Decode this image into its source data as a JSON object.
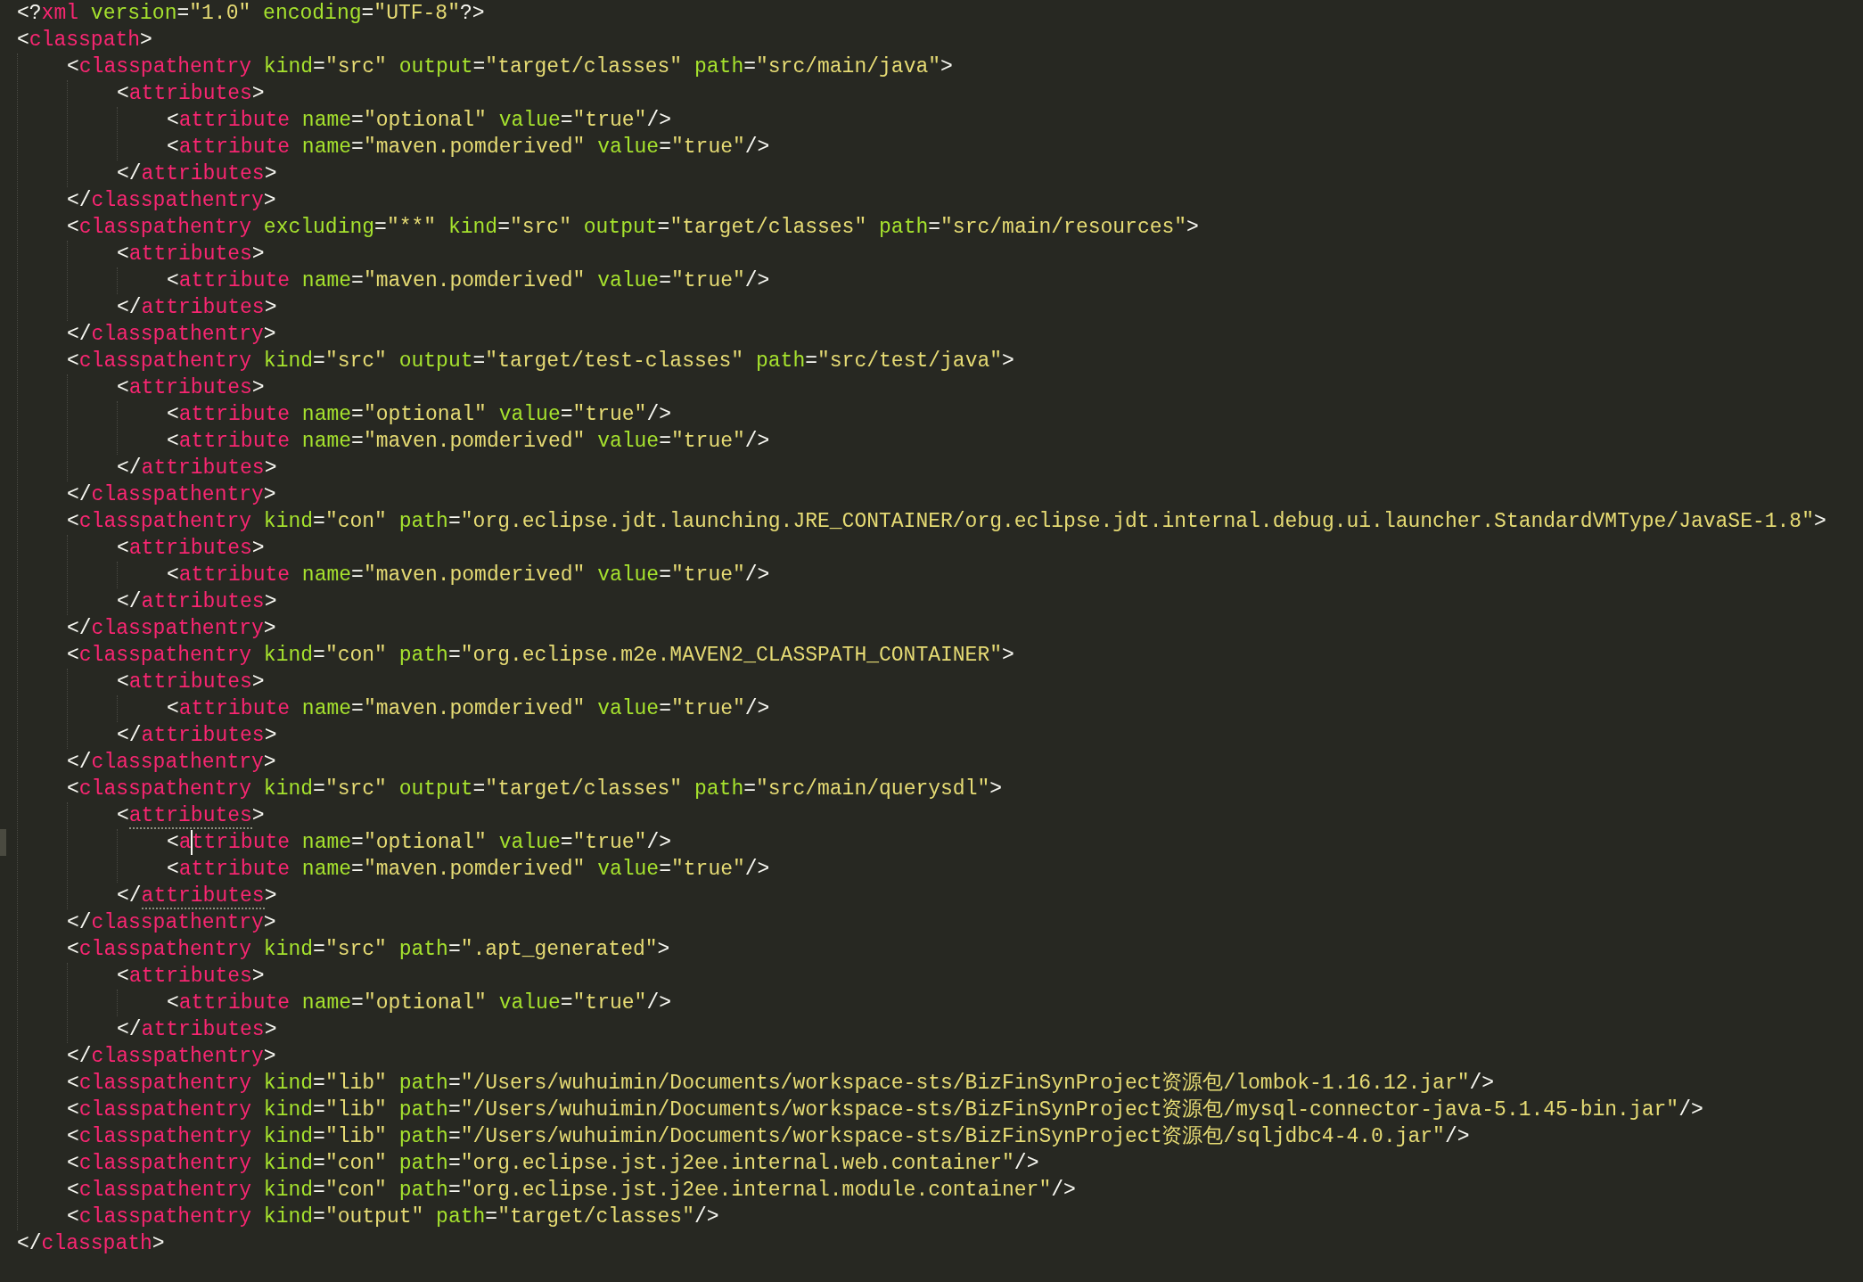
{
  "editor": {
    "lines": [
      {
        "tokens": [
          {
            "kind": "punct",
            "text": "<?"
          },
          {
            "kind": "tag",
            "text": "xml"
          },
          {
            "kind": "attr",
            "text": " version"
          },
          {
            "kind": "punct",
            "text": "="
          },
          {
            "kind": "string",
            "text": "\"1.0\""
          },
          {
            "kind": "attr",
            "text": " encoding"
          },
          {
            "kind": "punct",
            "text": "="
          },
          {
            "kind": "string",
            "text": "\"UTF-8\""
          },
          {
            "kind": "punct",
            "text": "?>"
          }
        ]
      },
      {
        "tokens": [
          {
            "kind": "punct",
            "text": "<"
          },
          {
            "kind": "tag",
            "text": "classpath"
          },
          {
            "kind": "punct",
            "text": ">"
          }
        ],
        "children": [
          {
            "tokens": [
              {
                "kind": "punct",
                "text": "<"
              },
              {
                "kind": "tag",
                "text": "classpathentry"
              },
              {
                "kind": "attr",
                "text": " kind"
              },
              {
                "kind": "punct",
                "text": "="
              },
              {
                "kind": "string",
                "text": "\"src\""
              },
              {
                "kind": "attr",
                "text": " output"
              },
              {
                "kind": "punct",
                "text": "="
              },
              {
                "kind": "string",
                "text": "\"target/classes\""
              },
              {
                "kind": "attr",
                "text": " path"
              },
              {
                "kind": "punct",
                "text": "="
              },
              {
                "kind": "string",
                "text": "\"src/main/java\""
              },
              {
                "kind": "punct",
                "text": ">"
              }
            ],
            "children": [
              {
                "tokens": [
                  {
                    "kind": "punct",
                    "text": "<"
                  },
                  {
                    "kind": "tag",
                    "text": "attributes"
                  },
                  {
                    "kind": "punct",
                    "text": ">"
                  }
                ],
                "children": [
                  {
                    "tokens": [
                      {
                        "kind": "punct",
                        "text": "<"
                      },
                      {
                        "kind": "tag",
                        "text": "attribute"
                      },
                      {
                        "kind": "attr",
                        "text": " name"
                      },
                      {
                        "kind": "punct",
                        "text": "="
                      },
                      {
                        "kind": "string",
                        "text": "\"optional\""
                      },
                      {
                        "kind": "attr",
                        "text": " value"
                      },
                      {
                        "kind": "punct",
                        "text": "="
                      },
                      {
                        "kind": "string",
                        "text": "\"true\""
                      },
                      {
                        "kind": "punct",
                        "text": "/>"
                      }
                    ]
                  },
                  {
                    "tokens": [
                      {
                        "kind": "punct",
                        "text": "<"
                      },
                      {
                        "kind": "tag",
                        "text": "attribute"
                      },
                      {
                        "kind": "attr",
                        "text": " name"
                      },
                      {
                        "kind": "punct",
                        "text": "="
                      },
                      {
                        "kind": "string",
                        "text": "\"maven.pomderived\""
                      },
                      {
                        "kind": "attr",
                        "text": " value"
                      },
                      {
                        "kind": "punct",
                        "text": "="
                      },
                      {
                        "kind": "string",
                        "text": "\"true\""
                      },
                      {
                        "kind": "punct",
                        "text": "/>"
                      }
                    ]
                  }
                ]
              },
              {
                "tokens": [
                  {
                    "kind": "punct",
                    "text": "</"
                  },
                  {
                    "kind": "tag",
                    "text": "attributes"
                  },
                  {
                    "kind": "punct",
                    "text": ">"
                  }
                ]
              }
            ]
          },
          {
            "tokens": [
              {
                "kind": "punct",
                "text": "</"
              },
              {
                "kind": "tag",
                "text": "classpathentry"
              },
              {
                "kind": "punct",
                "text": ">"
              }
            ]
          },
          {
            "tokens": [
              {
                "kind": "punct",
                "text": "<"
              },
              {
                "kind": "tag",
                "text": "classpathentry"
              },
              {
                "kind": "attr",
                "text": " excluding"
              },
              {
                "kind": "punct",
                "text": "="
              },
              {
                "kind": "string",
                "text": "\"**\""
              },
              {
                "kind": "attr",
                "text": " kind"
              },
              {
                "kind": "punct",
                "text": "="
              },
              {
                "kind": "string",
                "text": "\"src\""
              },
              {
                "kind": "attr",
                "text": " output"
              },
              {
                "kind": "punct",
                "text": "="
              },
              {
                "kind": "string",
                "text": "\"target/classes\""
              },
              {
                "kind": "attr",
                "text": " path"
              },
              {
                "kind": "punct",
                "text": "="
              },
              {
                "kind": "string",
                "text": "\"src/main/resources\""
              },
              {
                "kind": "punct",
                "text": ">"
              }
            ],
            "children": [
              {
                "tokens": [
                  {
                    "kind": "punct",
                    "text": "<"
                  },
                  {
                    "kind": "tag",
                    "text": "attributes"
                  },
                  {
                    "kind": "punct",
                    "text": ">"
                  }
                ],
                "children": [
                  {
                    "tokens": [
                      {
                        "kind": "punct",
                        "text": "<"
                      },
                      {
                        "kind": "tag",
                        "text": "attribute"
                      },
                      {
                        "kind": "attr",
                        "text": " name"
                      },
                      {
                        "kind": "punct",
                        "text": "="
                      },
                      {
                        "kind": "string",
                        "text": "\"maven.pomderived\""
                      },
                      {
                        "kind": "attr",
                        "text": " value"
                      },
                      {
                        "kind": "punct",
                        "text": "="
                      },
                      {
                        "kind": "string",
                        "text": "\"true\""
                      },
                      {
                        "kind": "punct",
                        "text": "/>"
                      }
                    ]
                  }
                ]
              },
              {
                "tokens": [
                  {
                    "kind": "punct",
                    "text": "</"
                  },
                  {
                    "kind": "tag",
                    "text": "attributes"
                  },
                  {
                    "kind": "punct",
                    "text": ">"
                  }
                ]
              }
            ]
          },
          {
            "tokens": [
              {
                "kind": "punct",
                "text": "</"
              },
              {
                "kind": "tag",
                "text": "classpathentry"
              },
              {
                "kind": "punct",
                "text": ">"
              }
            ]
          },
          {
            "tokens": [
              {
                "kind": "punct",
                "text": "<"
              },
              {
                "kind": "tag",
                "text": "classpathentry"
              },
              {
                "kind": "attr",
                "text": " kind"
              },
              {
                "kind": "punct",
                "text": "="
              },
              {
                "kind": "string",
                "text": "\"src\""
              },
              {
                "kind": "attr",
                "text": " output"
              },
              {
                "kind": "punct",
                "text": "="
              },
              {
                "kind": "string",
                "text": "\"target/test-classes\""
              },
              {
                "kind": "attr",
                "text": " path"
              },
              {
                "kind": "punct",
                "text": "="
              },
              {
                "kind": "string",
                "text": "\"src/test/java\""
              },
              {
                "kind": "punct",
                "text": ">"
              }
            ],
            "children": [
              {
                "tokens": [
                  {
                    "kind": "punct",
                    "text": "<"
                  },
                  {
                    "kind": "tag",
                    "text": "attributes"
                  },
                  {
                    "kind": "punct",
                    "text": ">"
                  }
                ],
                "children": [
                  {
                    "tokens": [
                      {
                        "kind": "punct",
                        "text": "<"
                      },
                      {
                        "kind": "tag",
                        "text": "attribute"
                      },
                      {
                        "kind": "attr",
                        "text": " name"
                      },
                      {
                        "kind": "punct",
                        "text": "="
                      },
                      {
                        "kind": "string",
                        "text": "\"optional\""
                      },
                      {
                        "kind": "attr",
                        "text": " value"
                      },
                      {
                        "kind": "punct",
                        "text": "="
                      },
                      {
                        "kind": "string",
                        "text": "\"true\""
                      },
                      {
                        "kind": "punct",
                        "text": "/>"
                      }
                    ]
                  },
                  {
                    "tokens": [
                      {
                        "kind": "punct",
                        "text": "<"
                      },
                      {
                        "kind": "tag",
                        "text": "attribute"
                      },
                      {
                        "kind": "attr",
                        "text": " name"
                      },
                      {
                        "kind": "punct",
                        "text": "="
                      },
                      {
                        "kind": "string",
                        "text": "\"maven.pomderived\""
                      },
                      {
                        "kind": "attr",
                        "text": " value"
                      },
                      {
                        "kind": "punct",
                        "text": "="
                      },
                      {
                        "kind": "string",
                        "text": "\"true\""
                      },
                      {
                        "kind": "punct",
                        "text": "/>"
                      }
                    ]
                  }
                ]
              },
              {
                "tokens": [
                  {
                    "kind": "punct",
                    "text": "</"
                  },
                  {
                    "kind": "tag",
                    "text": "attributes"
                  },
                  {
                    "kind": "punct",
                    "text": ">"
                  }
                ]
              }
            ]
          },
          {
            "tokens": [
              {
                "kind": "punct",
                "text": "</"
              },
              {
                "kind": "tag",
                "text": "classpathentry"
              },
              {
                "kind": "punct",
                "text": ">"
              }
            ]
          },
          {
            "tokens": [
              {
                "kind": "punct",
                "text": "<"
              },
              {
                "kind": "tag",
                "text": "classpathentry"
              },
              {
                "kind": "attr",
                "text": " kind"
              },
              {
                "kind": "punct",
                "text": "="
              },
              {
                "kind": "string",
                "text": "\"con\""
              },
              {
                "kind": "attr",
                "text": " path"
              },
              {
                "kind": "punct",
                "text": "="
              },
              {
                "kind": "string",
                "text": "\"org.eclipse.jdt.launching.JRE_CONTAINER/org.eclipse.jdt.internal.debug.ui.launcher.StandardVMType/JavaSE-1.8\""
              },
              {
                "kind": "punct",
                "text": ">"
              }
            ],
            "children": [
              {
                "tokens": [
                  {
                    "kind": "punct",
                    "text": "<"
                  },
                  {
                    "kind": "tag",
                    "text": "attributes"
                  },
                  {
                    "kind": "punct",
                    "text": ">"
                  }
                ],
                "children": [
                  {
                    "tokens": [
                      {
                        "kind": "punct",
                        "text": "<"
                      },
                      {
                        "kind": "tag",
                        "text": "attribute"
                      },
                      {
                        "kind": "attr",
                        "text": " name"
                      },
                      {
                        "kind": "punct",
                        "text": "="
                      },
                      {
                        "kind": "string",
                        "text": "\"maven.pomderived\""
                      },
                      {
                        "kind": "attr",
                        "text": " value"
                      },
                      {
                        "kind": "punct",
                        "text": "="
                      },
                      {
                        "kind": "string",
                        "text": "\"true\""
                      },
                      {
                        "kind": "punct",
                        "text": "/>"
                      }
                    ]
                  }
                ]
              },
              {
                "tokens": [
                  {
                    "kind": "punct",
                    "text": "</"
                  },
                  {
                    "kind": "tag",
                    "text": "attributes"
                  },
                  {
                    "kind": "punct",
                    "text": ">"
                  }
                ]
              }
            ]
          },
          {
            "tokens": [
              {
                "kind": "punct",
                "text": "</"
              },
              {
                "kind": "tag",
                "text": "classpathentry"
              },
              {
                "kind": "punct",
                "text": ">"
              }
            ]
          },
          {
            "tokens": [
              {
                "kind": "punct",
                "text": "<"
              },
              {
                "kind": "tag",
                "text": "classpathentry"
              },
              {
                "kind": "attr",
                "text": " kind"
              },
              {
                "kind": "punct",
                "text": "="
              },
              {
                "kind": "string",
                "text": "\"con\""
              },
              {
                "kind": "attr",
                "text": " path"
              },
              {
                "kind": "punct",
                "text": "="
              },
              {
                "kind": "string",
                "text": "\"org.eclipse.m2e.MAVEN2_CLASSPATH_CONTAINER\""
              },
              {
                "kind": "punct",
                "text": ">"
              }
            ],
            "children": [
              {
                "tokens": [
                  {
                    "kind": "punct",
                    "text": "<"
                  },
                  {
                    "kind": "tag",
                    "text": "attributes"
                  },
                  {
                    "kind": "punct",
                    "text": ">"
                  }
                ],
                "children": [
                  {
                    "tokens": [
                      {
                        "kind": "punct",
                        "text": "<"
                      },
                      {
                        "kind": "tag",
                        "text": "attribute"
                      },
                      {
                        "kind": "attr",
                        "text": " name"
                      },
                      {
                        "kind": "punct",
                        "text": "="
                      },
                      {
                        "kind": "string",
                        "text": "\"maven.pomderived\""
                      },
                      {
                        "kind": "attr",
                        "text": " value"
                      },
                      {
                        "kind": "punct",
                        "text": "="
                      },
                      {
                        "kind": "string",
                        "text": "\"true\""
                      },
                      {
                        "kind": "punct",
                        "text": "/>"
                      }
                    ]
                  }
                ]
              },
              {
                "tokens": [
                  {
                    "kind": "punct",
                    "text": "</"
                  },
                  {
                    "kind": "tag",
                    "text": "attributes"
                  },
                  {
                    "kind": "punct",
                    "text": ">"
                  }
                ]
              }
            ]
          },
          {
            "tokens": [
              {
                "kind": "punct",
                "text": "</"
              },
              {
                "kind": "tag",
                "text": "classpathentry"
              },
              {
                "kind": "punct",
                "text": ">"
              }
            ]
          },
          {
            "tokens": [
              {
                "kind": "punct",
                "text": "<"
              },
              {
                "kind": "tag",
                "text": "classpathentry"
              },
              {
                "kind": "attr",
                "text": " kind"
              },
              {
                "kind": "punct",
                "text": "="
              },
              {
                "kind": "string",
                "text": "\"src\""
              },
              {
                "kind": "attr",
                "text": " output"
              },
              {
                "kind": "punct",
                "text": "="
              },
              {
                "kind": "string",
                "text": "\"target/classes\""
              },
              {
                "kind": "attr",
                "text": " path"
              },
              {
                "kind": "punct",
                "text": "="
              },
              {
                "kind": "string",
                "text": "\"src/main/querysdl\""
              },
              {
                "kind": "punct",
                "text": ">"
              }
            ],
            "children": [
              {
                "tokens": [
                  {
                    "kind": "punct",
                    "text": "<"
                  },
                  {
                    "kind": "matched_tag",
                    "text": "attributes"
                  },
                  {
                    "kind": "punct",
                    "text": ">"
                  }
                ],
                "children": [
                  {
                    "tokens": [
                      {
                        "kind": "punct",
                        "text": "<"
                      },
                      {
                        "kind": "tag",
                        "text": "a"
                      },
                      {
                        "kind": "caret"
                      },
                      {
                        "kind": "tag",
                        "text": "ttribute"
                      },
                      {
                        "kind": "attr",
                        "text": " name"
                      },
                      {
                        "kind": "punct",
                        "text": "="
                      },
                      {
                        "kind": "string",
                        "text": "\"optional\""
                      },
                      {
                        "kind": "attr",
                        "text": " value"
                      },
                      {
                        "kind": "punct",
                        "text": "="
                      },
                      {
                        "kind": "string",
                        "text": "\"true\""
                      },
                      {
                        "kind": "punct",
                        "text": "/>"
                      }
                    ]
                  },
                  {
                    "tokens": [
                      {
                        "kind": "punct",
                        "text": "<"
                      },
                      {
                        "kind": "tag",
                        "text": "attribute"
                      },
                      {
                        "kind": "attr",
                        "text": " name"
                      },
                      {
                        "kind": "punct",
                        "text": "="
                      },
                      {
                        "kind": "string",
                        "text": "\"maven.pomderived\""
                      },
                      {
                        "kind": "attr",
                        "text": " value"
                      },
                      {
                        "kind": "punct",
                        "text": "="
                      },
                      {
                        "kind": "string",
                        "text": "\"true\""
                      },
                      {
                        "kind": "punct",
                        "text": "/>"
                      }
                    ]
                  }
                ]
              },
              {
                "tokens": [
                  {
                    "kind": "punct",
                    "text": "</"
                  },
                  {
                    "kind": "matched_tag",
                    "text": "attributes"
                  },
                  {
                    "kind": "punct",
                    "text": ">"
                  }
                ]
              }
            ]
          },
          {
            "tokens": [
              {
                "kind": "punct",
                "text": "</"
              },
              {
                "kind": "tag",
                "text": "classpathentry"
              },
              {
                "kind": "punct",
                "text": ">"
              }
            ]
          },
          {
            "tokens": [
              {
                "kind": "punct",
                "text": "<"
              },
              {
                "kind": "tag",
                "text": "classpathentry"
              },
              {
                "kind": "attr",
                "text": " kind"
              },
              {
                "kind": "punct",
                "text": "="
              },
              {
                "kind": "string",
                "text": "\"src\""
              },
              {
                "kind": "attr",
                "text": " path"
              },
              {
                "kind": "punct",
                "text": "="
              },
              {
                "kind": "string",
                "text": "\".apt_generated\""
              },
              {
                "kind": "punct",
                "text": ">"
              }
            ],
            "children": [
              {
                "tokens": [
                  {
                    "kind": "punct",
                    "text": "<"
                  },
                  {
                    "kind": "tag",
                    "text": "attributes"
                  },
                  {
                    "kind": "punct",
                    "text": ">"
                  }
                ],
                "children": [
                  {
                    "tokens": [
                      {
                        "kind": "punct",
                        "text": "<"
                      },
                      {
                        "kind": "tag",
                        "text": "attribute"
                      },
                      {
                        "kind": "attr",
                        "text": " name"
                      },
                      {
                        "kind": "punct",
                        "text": "="
                      },
                      {
                        "kind": "string",
                        "text": "\"optional\""
                      },
                      {
                        "kind": "attr",
                        "text": " value"
                      },
                      {
                        "kind": "punct",
                        "text": "="
                      },
                      {
                        "kind": "string",
                        "text": "\"true\""
                      },
                      {
                        "kind": "punct",
                        "text": "/>"
                      }
                    ]
                  }
                ]
              },
              {
                "tokens": [
                  {
                    "kind": "punct",
                    "text": "</"
                  },
                  {
                    "kind": "tag",
                    "text": "attributes"
                  },
                  {
                    "kind": "punct",
                    "text": ">"
                  }
                ]
              }
            ]
          },
          {
            "tokens": [
              {
                "kind": "punct",
                "text": "</"
              },
              {
                "kind": "tag",
                "text": "classpathentry"
              },
              {
                "kind": "punct",
                "text": ">"
              }
            ]
          },
          {
            "tokens": [
              {
                "kind": "punct",
                "text": "<"
              },
              {
                "kind": "tag",
                "text": "classpathentry"
              },
              {
                "kind": "attr",
                "text": " kind"
              },
              {
                "kind": "punct",
                "text": "="
              },
              {
                "kind": "string",
                "text": "\"lib\""
              },
              {
                "kind": "attr",
                "text": " path"
              },
              {
                "kind": "punct",
                "text": "="
              },
              {
                "kind": "string",
                "text": "\"/Users/wuhuimin/Documents/workspace-sts/BizFinSynProject资源包/lombok-1.16.12.jar\""
              },
              {
                "kind": "punct",
                "text": "/>"
              }
            ]
          },
          {
            "tokens": [
              {
                "kind": "punct",
                "text": "<"
              },
              {
                "kind": "tag",
                "text": "classpathentry"
              },
              {
                "kind": "attr",
                "text": " kind"
              },
              {
                "kind": "punct",
                "text": "="
              },
              {
                "kind": "string",
                "text": "\"lib\""
              },
              {
                "kind": "attr",
                "text": " path"
              },
              {
                "kind": "punct",
                "text": "="
              },
              {
                "kind": "string",
                "text": "\"/Users/wuhuimin/Documents/workspace-sts/BizFinSynProject资源包/mysql-connector-java-5.1.45-bin.jar\""
              },
              {
                "kind": "punct",
                "text": "/>"
              }
            ]
          },
          {
            "tokens": [
              {
                "kind": "punct",
                "text": "<"
              },
              {
                "kind": "tag",
                "text": "classpathentry"
              },
              {
                "kind": "attr",
                "text": " kind"
              },
              {
                "kind": "punct",
                "text": "="
              },
              {
                "kind": "string",
                "text": "\"lib\""
              },
              {
                "kind": "attr",
                "text": " path"
              },
              {
                "kind": "punct",
                "text": "="
              },
              {
                "kind": "string",
                "text": "\"/Users/wuhuimin/Documents/workspace-sts/BizFinSynProject资源包/sqljdbc4-4.0.jar\""
              },
              {
                "kind": "punct",
                "text": "/>"
              }
            ]
          },
          {
            "tokens": [
              {
                "kind": "punct",
                "text": "<"
              },
              {
                "kind": "tag",
                "text": "classpathentry"
              },
              {
                "kind": "attr",
                "text": " kind"
              },
              {
                "kind": "punct",
                "text": "="
              },
              {
                "kind": "string",
                "text": "\"con\""
              },
              {
                "kind": "attr",
                "text": " path"
              },
              {
                "kind": "punct",
                "text": "="
              },
              {
                "kind": "string",
                "text": "\"org.eclipse.jst.j2ee.internal.web.container\""
              },
              {
                "kind": "punct",
                "text": "/>"
              }
            ]
          },
          {
            "tokens": [
              {
                "kind": "punct",
                "text": "<"
              },
              {
                "kind": "tag",
                "text": "classpathentry"
              },
              {
                "kind": "attr",
                "text": " kind"
              },
              {
                "kind": "punct",
                "text": "="
              },
              {
                "kind": "string",
                "text": "\"con\""
              },
              {
                "kind": "attr",
                "text": " path"
              },
              {
                "kind": "punct",
                "text": "="
              },
              {
                "kind": "string",
                "text": "\"org.eclipse.jst.j2ee.internal.module.container\""
              },
              {
                "kind": "punct",
                "text": "/>"
              }
            ]
          },
          {
            "tokens": [
              {
                "kind": "punct",
                "text": "<"
              },
              {
                "kind": "tag",
                "text": "classpathentry"
              },
              {
                "kind": "attr",
                "text": " kind"
              },
              {
                "kind": "punct",
                "text": "="
              },
              {
                "kind": "string",
                "text": "\"output\""
              },
              {
                "kind": "attr",
                "text": " path"
              },
              {
                "kind": "punct",
                "text": "="
              },
              {
                "kind": "string",
                "text": "\"target/classes\""
              },
              {
                "kind": "punct",
                "text": "/>"
              }
            ]
          }
        ]
      },
      {
        "tokens": [
          {
            "kind": "punct",
            "text": "</"
          },
          {
            "kind": "tag",
            "text": "classpath"
          },
          {
            "kind": "punct",
            "text": ">"
          }
        ]
      }
    ]
  }
}
